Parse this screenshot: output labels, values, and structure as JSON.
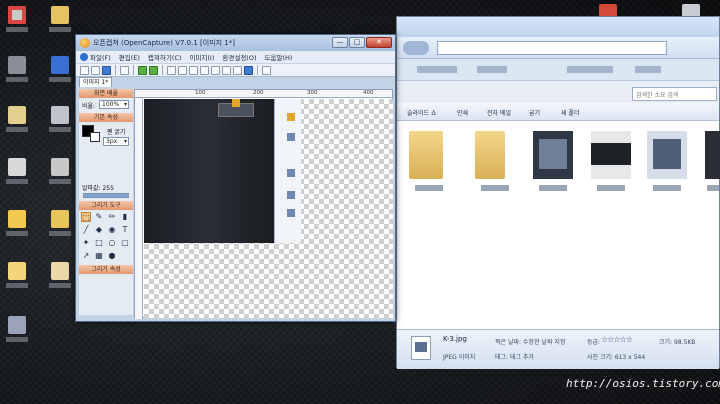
{
  "capture_window": {
    "title": "오픈캡쳐 (OpenCapture) V7.0.1 [이미지 1*]",
    "controls": {
      "minimize": "—",
      "maximize": "□",
      "close": "✕"
    },
    "menu": [
      "파일(F)",
      "편집(E)",
      "캡쳐하기(C)",
      "이미지(I)",
      "환경설정(O)",
      "도움말(H)"
    ],
    "tab": "이미지 1*",
    "sidebar": {
      "zoom_section": "화면 배율",
      "zoom_label": "비율:",
      "zoom_value": "100%",
      "basic_section": "기본 속성",
      "thickness_label": "펜 굵기",
      "thickness_value": "3px",
      "opacity_label": "알파값: 255",
      "opacity_fraction": 1.0,
      "tools_section": "그리기 도구",
      "props_section": "그리기 속성"
    },
    "ruler": [
      "100",
      "200",
      "300",
      "400"
    ]
  },
  "explorer": {
    "search_placeholder": "검색한 소요 검색",
    "toolbar": [
      "슬라이드 쇼",
      "인쇄",
      "전자 메일",
      "굽기",
      "새 폴더"
    ],
    "detail": {
      "file_name": "K-3.jpg",
      "file_type": "JPEG 이미지",
      "date_label": "찍은 날짜: 수정한 날짜 지정",
      "tags_label": "태그: 태그 추가",
      "rating_label": "등급:",
      "stars": "☆☆☆☆☆",
      "dims_label": "사진 크기: 613 x 544",
      "size_label": "크기: 98.5KB"
    }
  },
  "watermark": "http://osios.tistory.com",
  "colors": {
    "accent_orange": "#e39770",
    "title_blue": "#a8c0df"
  }
}
